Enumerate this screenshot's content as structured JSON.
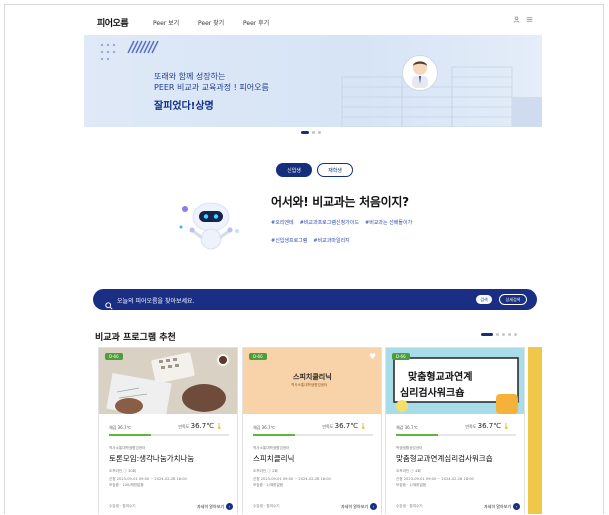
{
  "header": {
    "logo": "피어오름",
    "nav": [
      "Peer 보기",
      "Peer 찾기",
      "Peer 후기"
    ],
    "icons": [
      "user-icon",
      "menu-icon"
    ]
  },
  "hero": {
    "line1": "또래와 함께 성장하는",
    "line2": "PEER 비교과 교육과정 ! 피어오름",
    "line3": "잘피었다!상명",
    "dots": 3,
    "active_dot": 0
  },
  "toggle": {
    "left": "신입생",
    "right": "재학생"
  },
  "intro": {
    "title": "어서와! 비교과는 처음이지?",
    "tags_row1": [
      "#오리엔테",
      "#비교과프로그램신청가이드",
      "#비교과는 선배들이가"
    ],
    "tags_row2": [
      "#신입생프로그램",
      "#비교과마일리지"
    ]
  },
  "search": {
    "placeholder": "오늘의 피어오름을 찾아보세요.",
    "btn_search": "검색",
    "btn_detail": "상세검색"
  },
  "recommend": {
    "title": "비교과 프로그램 추천",
    "cards": [
      {
        "badge": "D-66",
        "temp_label": "체감 36.7℃",
        "satisfaction_label": "만족도",
        "satisfaction": "36.7℃",
        "progress": 0.35,
        "org": "역사소통대학생협업센터",
        "title": "토론모임:생각나눔가치나눔",
        "info1": "오프라인 ⓘ 30회",
        "info2": "신청 2023-09-01 09:00 ~ 2024-02-28 18:00",
        "info3": "모집중 · 100/제한없음",
        "foot_left": "수강생 · 참여수기",
        "foot_right": "자세히 알아보기"
      },
      {
        "badge": "D-66",
        "temp_label": "체감 36.7℃",
        "satisfaction_label": "만족도",
        "satisfaction": "36.7℃",
        "progress": 0.35,
        "org": "역사소통대학생협업센터",
        "title": "스피치클리닉",
        "thumb_title": "스피치클리닉",
        "thumb_sub": "역사소통대학생협업센터",
        "info1": "오프라인 ⓘ 2회",
        "info2": "신청 2023-09-01 09:00 ~ 2024-02-28 18:00",
        "info3": "모집중 · 1/제한없음",
        "foot_left": "수강생 · 참여수기",
        "foot_right": "자세히 알아보기"
      },
      {
        "badge": "D-66",
        "temp_label": "체감 36.7℃",
        "satisfaction_label": "만족도",
        "satisfaction": "36.7℃",
        "progress": 0.35,
        "org": "학생생활상담센터",
        "title": "맞춤형교과연계심리검사워크숍",
        "thumb_line1": "맞춤형교과연계",
        "thumb_line2": "심리검사워크숍",
        "info1": "오프라인 ⓘ 4회",
        "info2": "신청 2023-09-01 09:00 ~ 2024-02-28 18:00",
        "info3": "모집중 · 1/제한없음",
        "foot_left": "수강생 · 참여수기",
        "foot_right": "자세히 알아보기"
      }
    ],
    "dots": 5,
    "active_dot": 0
  },
  "colors": {
    "brand_navy": "#1a2f84",
    "badge_green": "#4f9d3a",
    "accent_yellow": "#f1c74a"
  }
}
